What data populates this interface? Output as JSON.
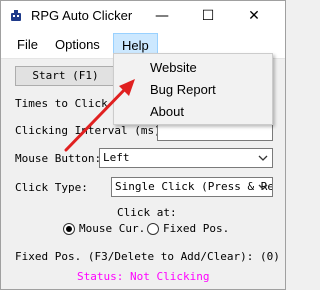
{
  "window": {
    "title": "RPG Auto Clicker",
    "controls": {
      "minimize": "—",
      "maximize": "☐",
      "close": "✕"
    }
  },
  "menu": {
    "file": "File",
    "options": "Options",
    "help": "Help"
  },
  "help_menu": {
    "items": [
      "Website",
      "Bug Report",
      "About"
    ]
  },
  "form": {
    "start_label": "Start (F1)",
    "times_label": "Times to Click (",
    "times_value": "",
    "interval_label": "Clicking Interval (ms):",
    "interval_value": "",
    "mouse_button_label": "Mouse Button:",
    "mouse_button_value": "Left",
    "click_type_label": "Click Type:",
    "click_type_value": "Single Click (Press & Releas",
    "click_at_label": "Click at:",
    "radio_mouse_label": "Mouse Cur.",
    "radio_fixed_label": "Fixed Pos.",
    "radio_selected": "mouse",
    "fixed_pos_label": "Fixed Pos. (F3/Delete to Add/Clear): (0)",
    "status": "Status: Not Clicking"
  },
  "colors": {
    "status_text": "#ff00ff",
    "help_highlight": "#cce8ff",
    "arrow": "#e02020"
  }
}
